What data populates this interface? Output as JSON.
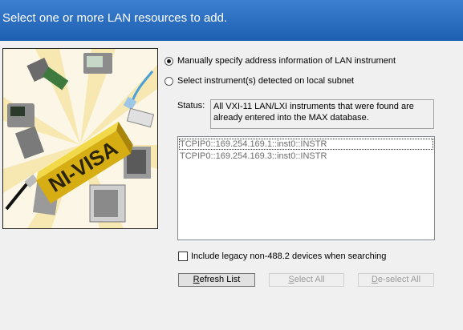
{
  "header": {
    "title": "Select one or more LAN resources to add."
  },
  "graphic": {
    "brand_text": "NI-VISA",
    "brand_color": "#e8c21a"
  },
  "options": {
    "manual_label": "Manually specify address information of LAN instrument",
    "manual_selected": true,
    "detect_label": "Select instrument(s) detected on local subnet",
    "detect_selected": false
  },
  "status": {
    "label": "Status:",
    "message": "All VXI-11 LAN/LXI instruments that were found are already entered into the MAX database."
  },
  "resources": [
    "TCPIP0::169.254.169.1::inst0::INSTR",
    "TCPIP0::169.254.169.3::inst0::INSTR"
  ],
  "legacy": {
    "label": "Include legacy non-488.2 devices when searching",
    "checked": false
  },
  "buttons": {
    "refresh_first": "R",
    "refresh_rest": "efresh List",
    "select_all_first": "S",
    "select_all_rest": "elect All",
    "deselect_first": "D",
    "deselect_rest": "e-select All"
  }
}
